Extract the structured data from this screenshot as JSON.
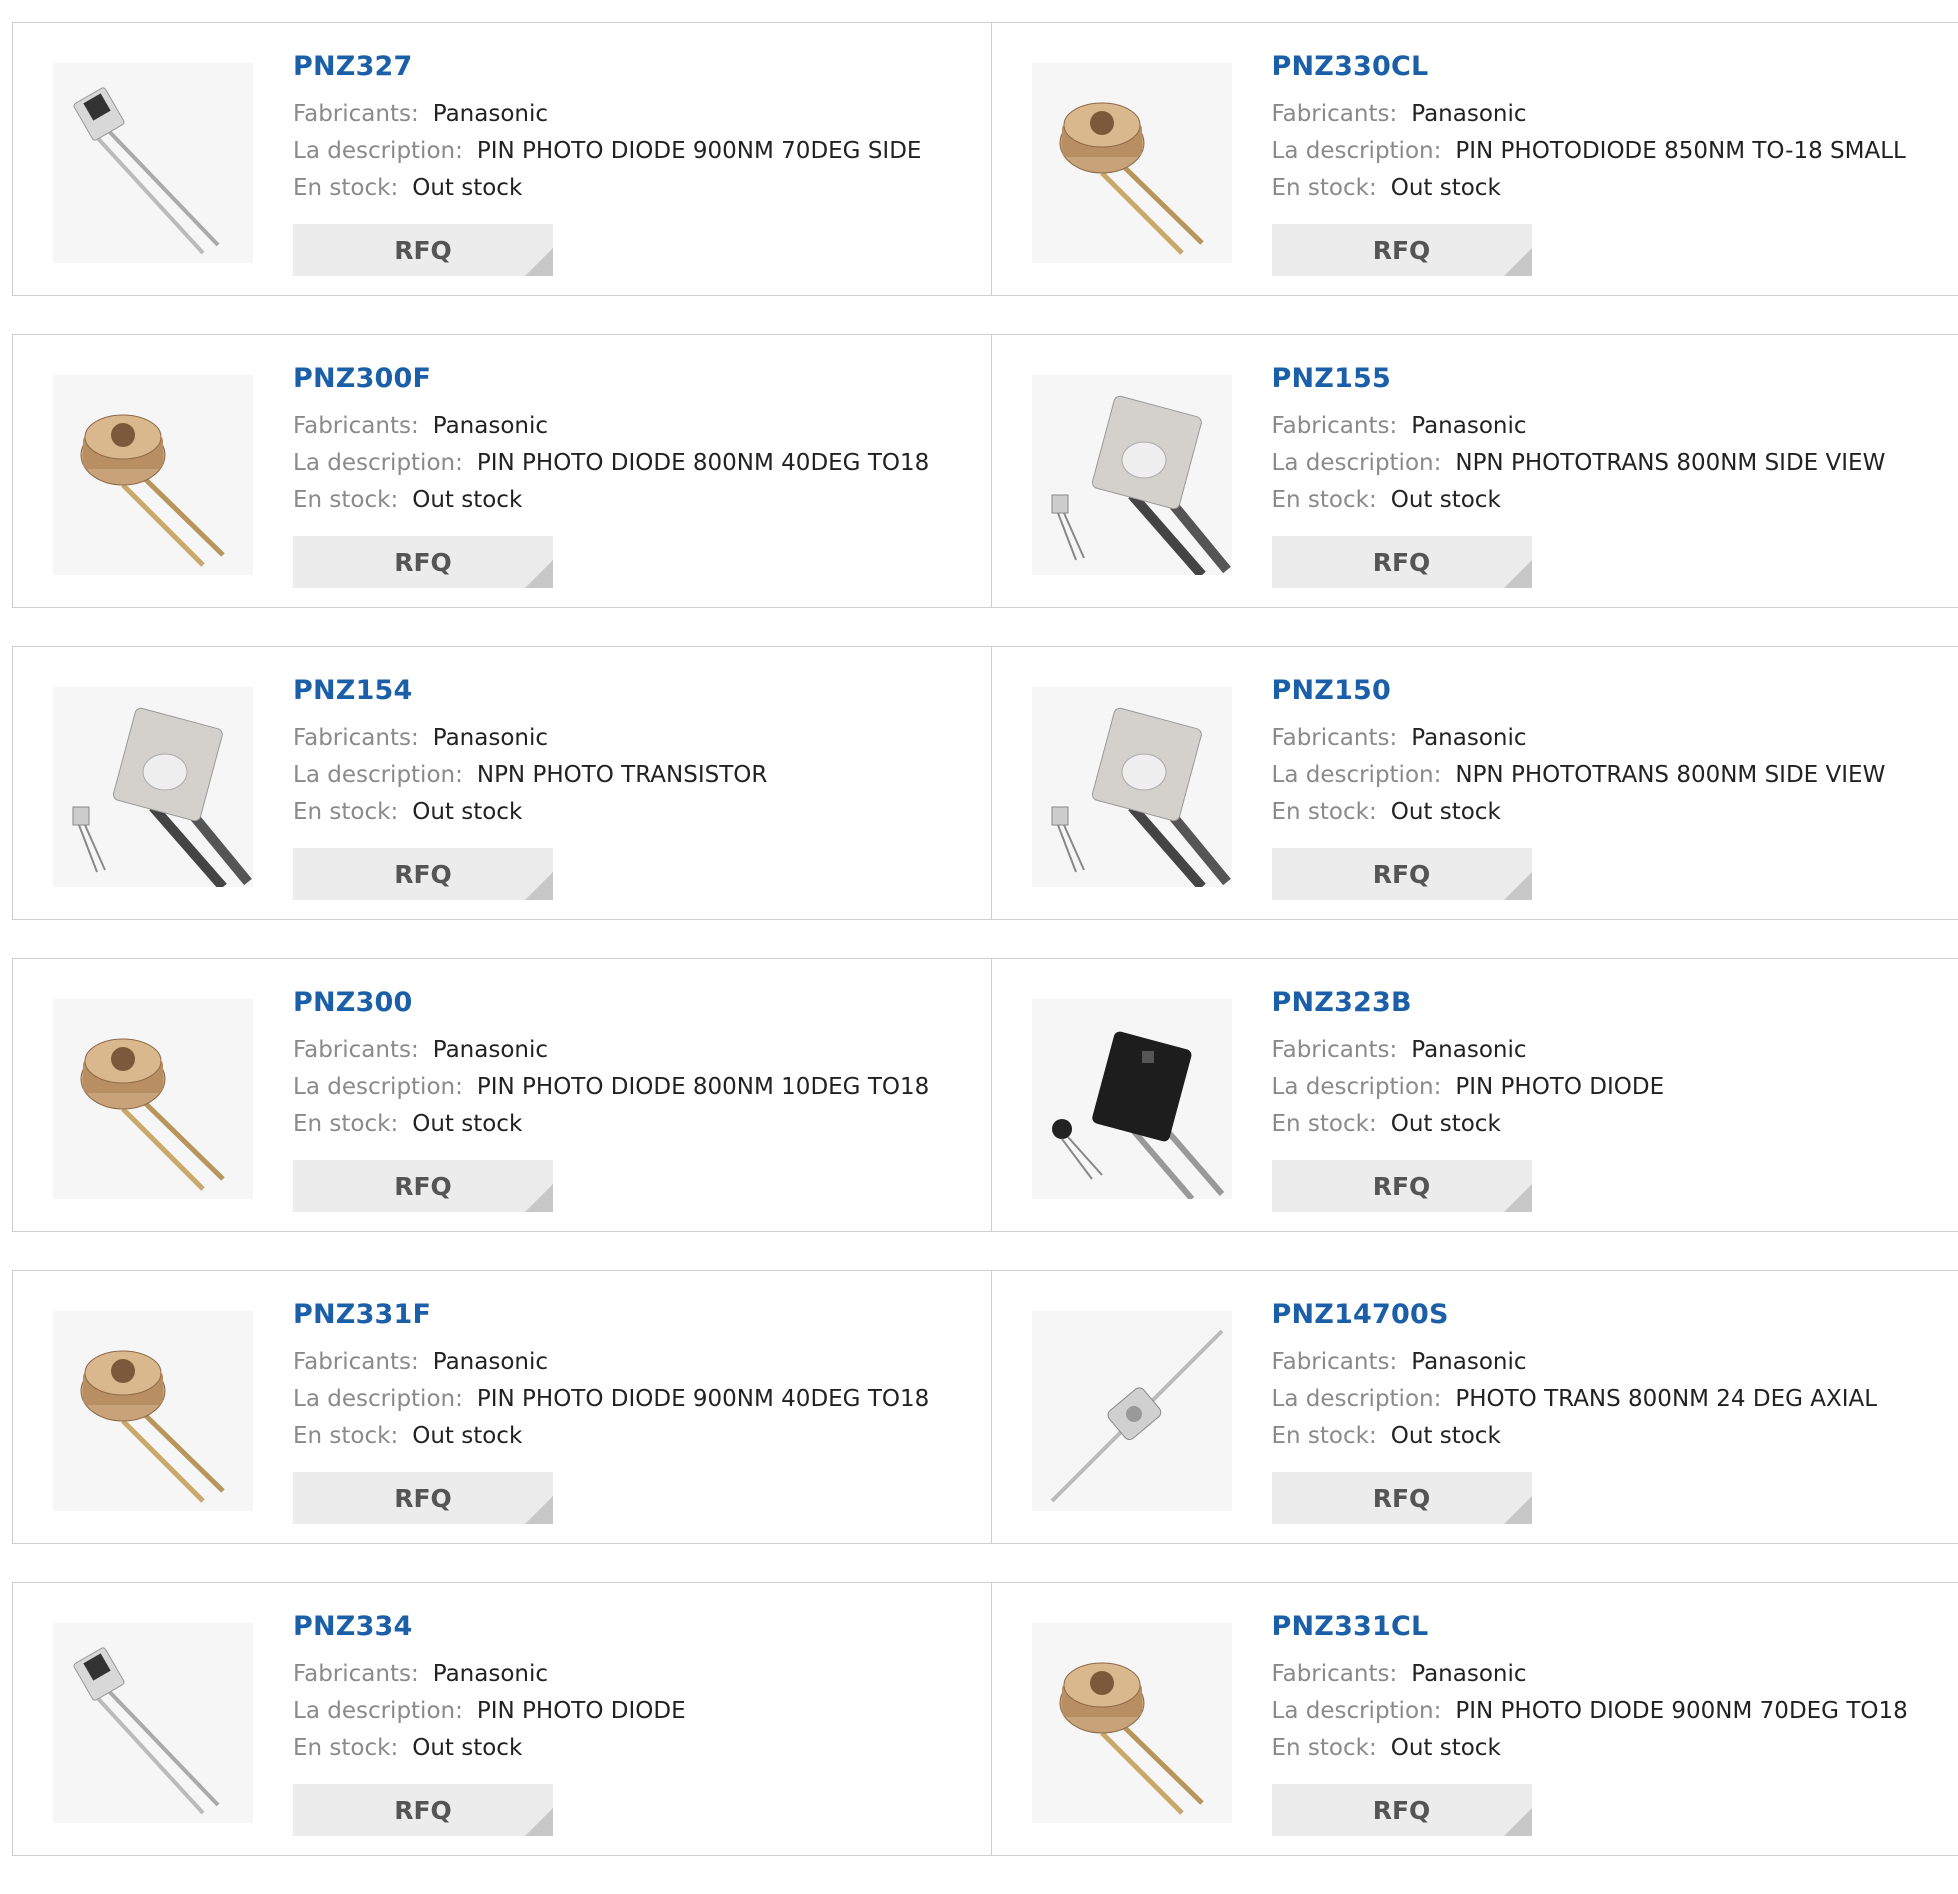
{
  "labels": {
    "manufacturer": "Fabricants:",
    "description": "La description:",
    "stock": "En stock:",
    "rfq": "RFQ"
  },
  "products": [
    {
      "pn": "PNZ327",
      "manufacturer": "Panasonic",
      "description": "PIN PHOTO DIODE 900NM 70DEG SIDE",
      "stock": "Out stock",
      "icon": "side-view-photodiode-icon"
    },
    {
      "pn": "PNZ330CL",
      "manufacturer": "Panasonic",
      "description": "PIN PHOTODIODE 850NM TO-18 SMALL",
      "stock": "Out stock",
      "icon": "to18-photodiode-icon"
    },
    {
      "pn": "PNZ300F",
      "manufacturer": "Panasonic",
      "description": "PIN PHOTO DIODE 800NM 40DEG TO18",
      "stock": "Out stock",
      "icon": "to18-photodiode-icon"
    },
    {
      "pn": "PNZ155",
      "manufacturer": "Panasonic",
      "description": "NPN PHOTOTRANS 800NM SIDE VIEW",
      "stock": "Out stock",
      "icon": "side-view-phototransistor-icon"
    },
    {
      "pn": "PNZ154",
      "manufacturer": "Panasonic",
      "description": "NPN PHOTO TRANSISTOR",
      "stock": "Out stock",
      "icon": "side-view-phototransistor-icon"
    },
    {
      "pn": "PNZ150",
      "manufacturer": "Panasonic",
      "description": "NPN PHOTOTRANS 800NM SIDE VIEW",
      "stock": "Out stock",
      "icon": "side-view-phototransistor-icon"
    },
    {
      "pn": "PNZ300",
      "manufacturer": "Panasonic",
      "description": "PIN PHOTO DIODE 800NM 10DEG TO18",
      "stock": "Out stock",
      "icon": "to18-photodiode-icon"
    },
    {
      "pn": "PNZ323B",
      "manufacturer": "Panasonic",
      "description": "PIN PHOTO DIODE",
      "stock": "Out stock",
      "icon": "black-photodiode-icon"
    },
    {
      "pn": "PNZ331F",
      "manufacturer": "Panasonic",
      "description": "PIN PHOTO DIODE 900NM 40DEG TO18",
      "stock": "Out stock",
      "icon": "to18-photodiode-icon"
    },
    {
      "pn": "PNZ14700S",
      "manufacturer": "Panasonic",
      "description": "PHOTO TRANS 800NM 24 DEG AXIAL",
      "stock": "Out stock",
      "icon": "axial-phototransistor-icon"
    },
    {
      "pn": "PNZ334",
      "manufacturer": "Panasonic",
      "description": "PIN PHOTO DIODE",
      "stock": "Out stock",
      "icon": "side-view-photodiode-icon"
    },
    {
      "pn": "PNZ331CL",
      "manufacturer": "Panasonic",
      "description": "PIN PHOTO DIODE 900NM 70DEG TO18",
      "stock": "Out stock",
      "icon": "to18-photodiode-icon"
    }
  ],
  "colors": {
    "link": "#1b5fa8",
    "label": "#8a8a8a",
    "border": "#cfcfcf",
    "button": "#ececec"
  }
}
